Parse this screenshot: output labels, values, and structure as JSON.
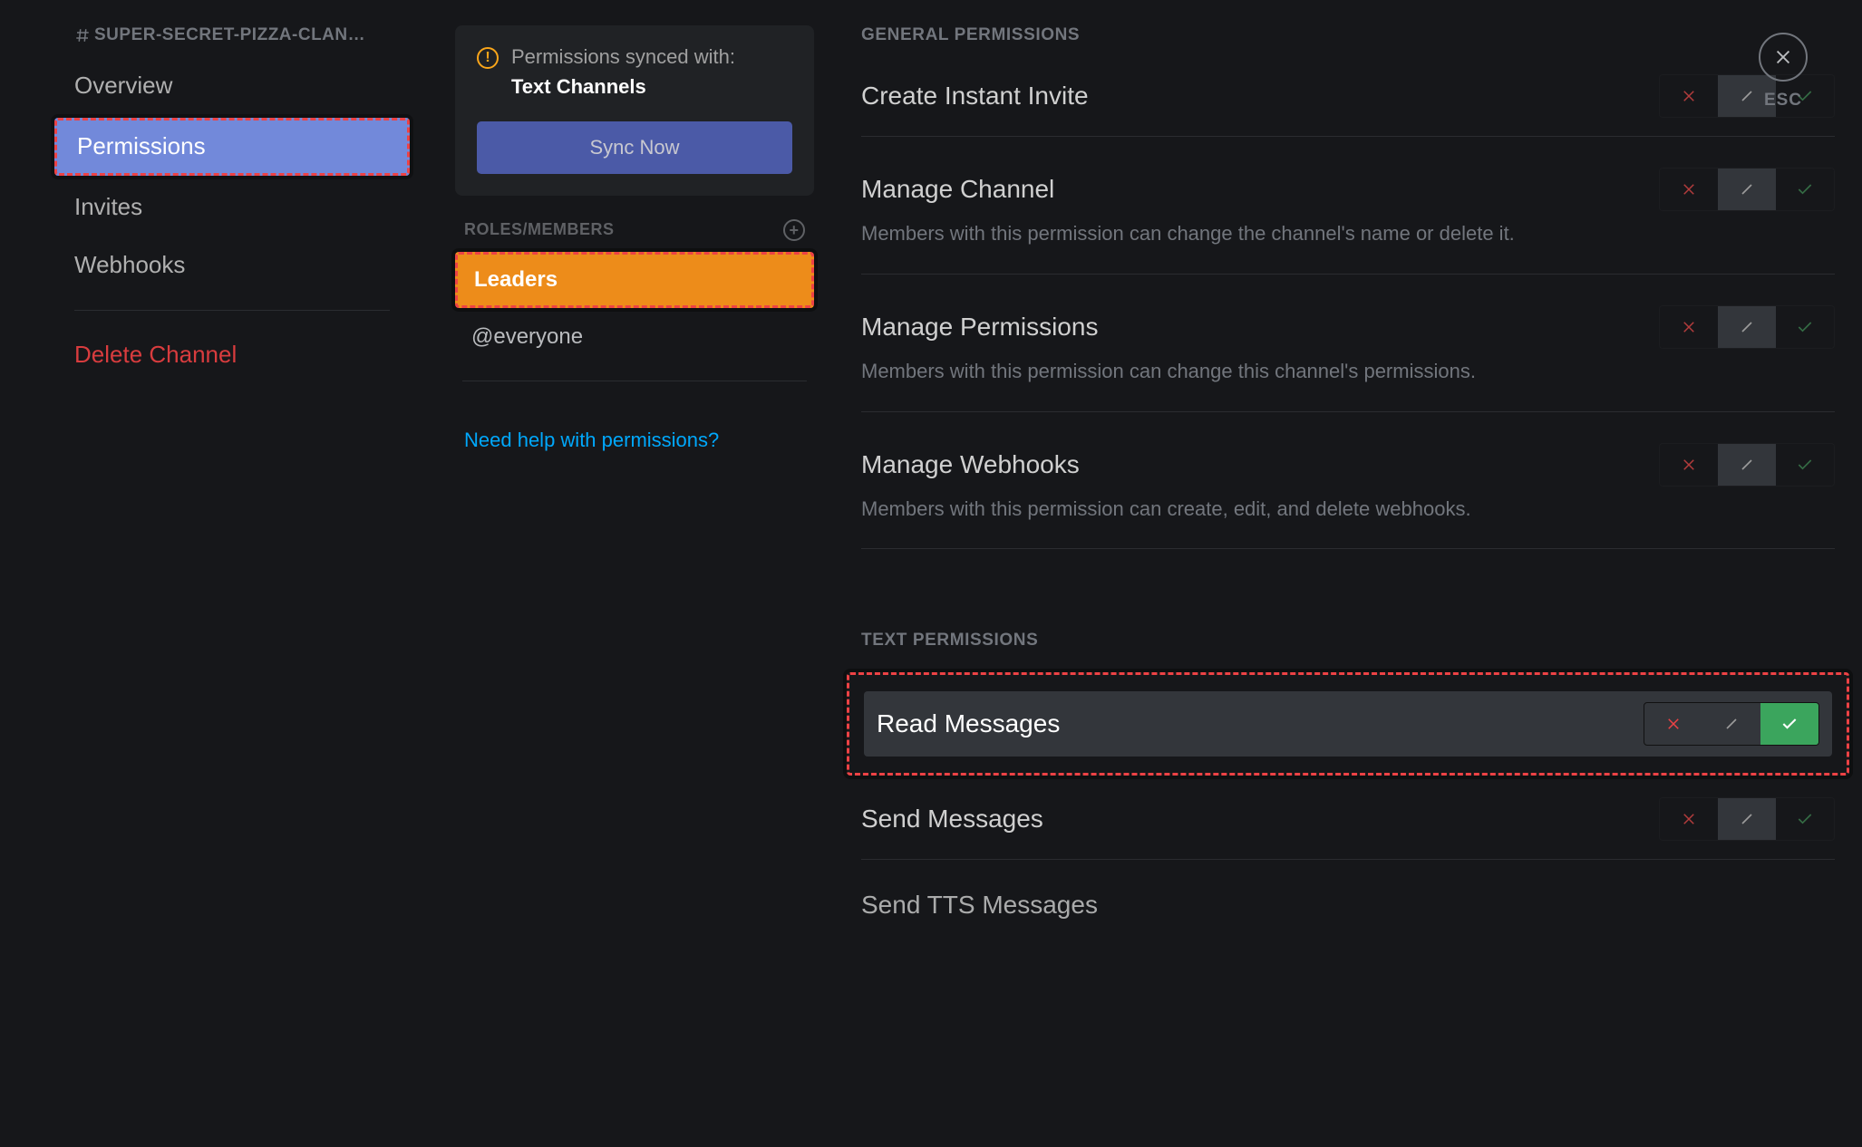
{
  "channel_title": "SUPER-SECRET-PIZZA-CLAN…",
  "sidebar": {
    "overview": "Overview",
    "permissions": "Permissions",
    "invites": "Invites",
    "webhooks": "Webhooks",
    "delete": "Delete Channel"
  },
  "sync": {
    "line1": "Permissions synced with:",
    "target": "Text Channels",
    "button": "Sync Now"
  },
  "roles": {
    "header": "ROLES/MEMBERS",
    "items": [
      {
        "label": "Leaders",
        "selected": true
      },
      {
        "label": "@everyone",
        "selected": false
      }
    ]
  },
  "help_link": "Need help with permissions?",
  "close_label": "ESC",
  "sections": {
    "general": "GENERAL PERMISSIONS",
    "text": "TEXT PERMISSIONS"
  },
  "perms": {
    "create_invite": {
      "title": "Create Instant Invite"
    },
    "manage_channel": {
      "title": "Manage Channel",
      "desc": "Members with this permission can change the channel's name or delete it."
    },
    "manage_permissions": {
      "title": "Manage Permissions",
      "desc": "Members with this permission can change this channel's permissions."
    },
    "manage_webhooks": {
      "title": "Manage Webhooks",
      "desc": "Members with this permission can create, edit, and delete webhooks."
    },
    "read_messages": {
      "title": "Read Messages"
    },
    "send_messages": {
      "title": "Send Messages"
    },
    "send_tts": {
      "title": "Send TTS Messages"
    }
  }
}
